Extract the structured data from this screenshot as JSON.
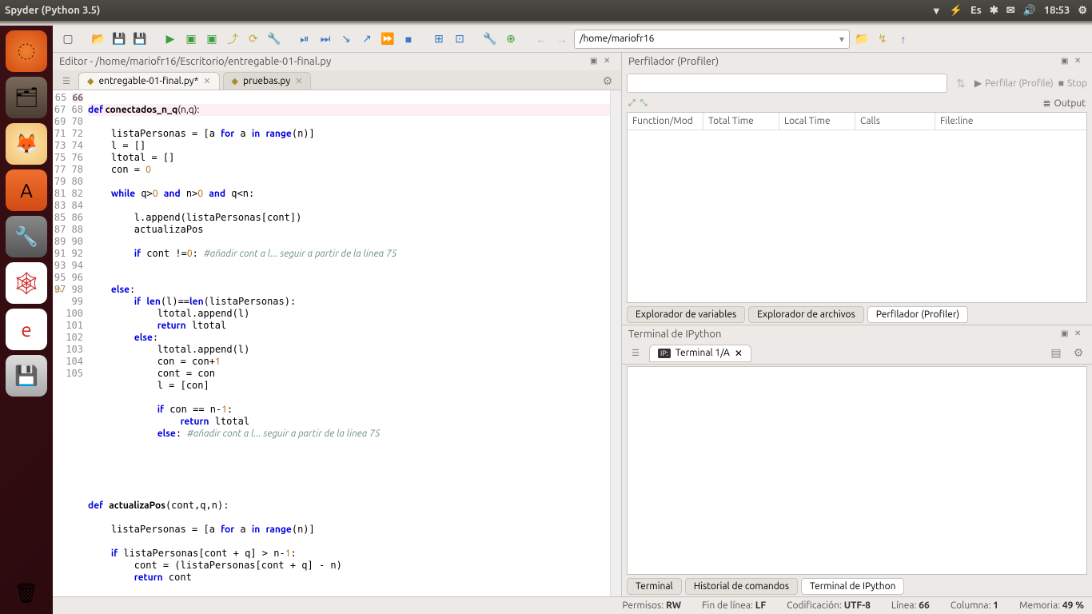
{
  "titlebar": {
    "title": "Spyder (Python 3.5)",
    "lang": "Es",
    "time": "18:53"
  },
  "toolbar": {
    "path": "/home/mariofr16"
  },
  "editor": {
    "header": "Editor - /home/mariofr16/Escritorio/entregable-01-final.py",
    "tabs": [
      {
        "label": "entregable-01-final.py*",
        "active": true
      },
      {
        "label": "pruebas.py",
        "active": false
      }
    ],
    "first_line": 65,
    "highlight_line": 66
  },
  "profiler": {
    "title": "Perfilador (Profiler)",
    "perfilar": "Perfilar (Profile)",
    "stop": "Stop",
    "output": "Output",
    "columns": [
      "Function/Mod",
      "Total Time",
      "Local Time",
      "Calls",
      "File:line"
    ],
    "bottom_tabs": [
      "Explorador de variables",
      "Explorador de archivos",
      "Perfilador (Profiler)"
    ]
  },
  "ipython": {
    "title": "Terminal de IPython",
    "tab": "Terminal 1/A",
    "bottom_tabs": [
      "Terminal",
      "Historial de comandos",
      "Terminal de IPython"
    ]
  },
  "statusbar": {
    "permisos_l": "Permisos:",
    "permisos_v": "RW",
    "eol_l": "Fin de línea:",
    "eol_v": "LF",
    "enc_l": "Codificación:",
    "enc_v": "UTF-8",
    "line_l": "Línea:",
    "line_v": "66",
    "col_l": "Columna:",
    "col_v": "1",
    "mem_l": "Memoria:",
    "mem_v": "49 %"
  }
}
